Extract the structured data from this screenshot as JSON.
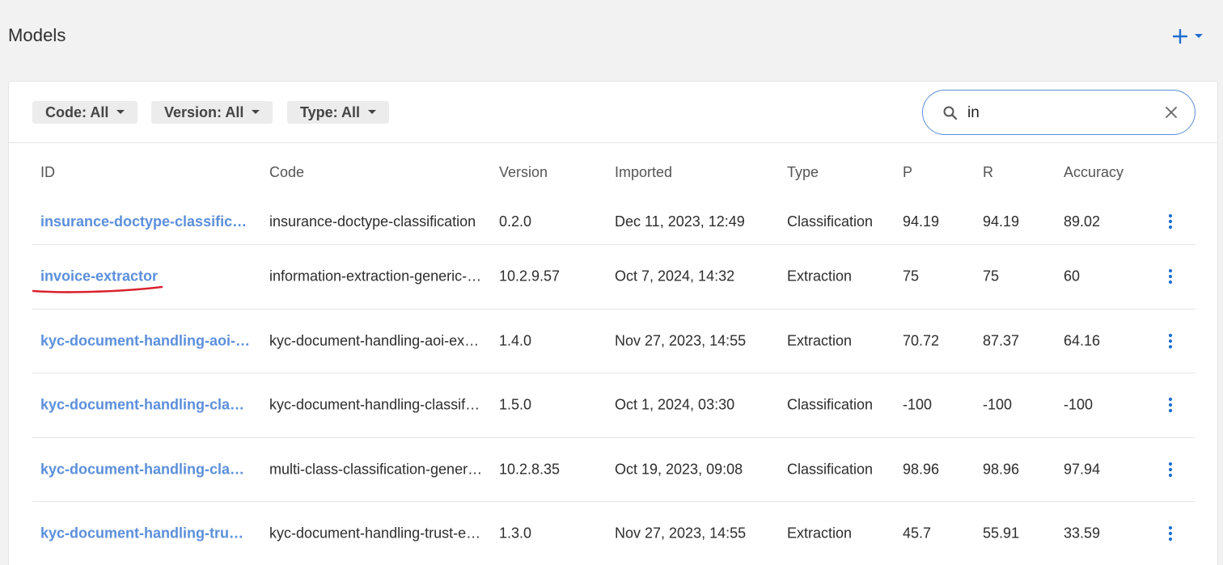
{
  "header": {
    "title": "Models"
  },
  "filters": [
    {
      "label": "Code: All"
    },
    {
      "label": "Version: All"
    },
    {
      "label": "Type: All"
    }
  ],
  "search": {
    "value": "in"
  },
  "table": {
    "columns": [
      "ID",
      "Code",
      "Version",
      "Imported",
      "Type",
      "P",
      "R",
      "Accuracy"
    ],
    "rows": [
      {
        "id": "insurance-doctype-classificatio…",
        "code": "insurance-doctype-classification",
        "version": "0.2.0",
        "imported": "Dec 11, 2023, 12:49",
        "type": "Classification",
        "p": "94.19",
        "r": "94.19",
        "accuracy": "89.02"
      },
      {
        "id": "invoice-extractor",
        "code": "information-extraction-generic-s…",
        "version": "10.2.9.57",
        "imported": "Oct 7, 2024, 14:32",
        "type": "Extraction",
        "p": "75",
        "r": "75",
        "accuracy": "60"
      },
      {
        "id": "kyc-document-handling-aoi-ext…",
        "code": "kyc-document-handling-aoi-extr…",
        "version": "1.4.0",
        "imported": "Nov 27, 2023, 14:55",
        "type": "Extraction",
        "p": "70.72",
        "r": "87.37",
        "accuracy": "64.16"
      },
      {
        "id": "kyc-document-handling-classifi…",
        "code": "kyc-document-handling-classifi…",
        "version": "1.5.0",
        "imported": "Oct 1, 2024, 03:30",
        "type": "Classification",
        "p": "-100",
        "r": "-100",
        "accuracy": "-100"
      },
      {
        "id": "kyc-document-handling-classifi…",
        "code": "multi-class-classification-generi…",
        "version": "10.2.8.35",
        "imported": "Oct 19, 2023, 09:08",
        "type": "Classification",
        "p": "98.96",
        "r": "98.96",
        "accuracy": "97.94"
      },
      {
        "id": "kyc-document-handling-trust-e…",
        "code": "kyc-document-handling-trust-ex…",
        "version": "1.3.0",
        "imported": "Nov 27, 2023, 14:55",
        "type": "Extraction",
        "p": "45.7",
        "r": "55.91",
        "accuracy": "33.59"
      }
    ]
  },
  "colors": {
    "accent": "#1f6fd1",
    "link": "#5b8fdc",
    "annotation": "#d9232d",
    "search_border": "#5a8ed8"
  },
  "icons": {
    "add": "plus-icon",
    "add_menu": "caret-down-icon",
    "search": "search-icon",
    "clear": "close-icon",
    "row_menu": "kebab-menu-icon"
  }
}
